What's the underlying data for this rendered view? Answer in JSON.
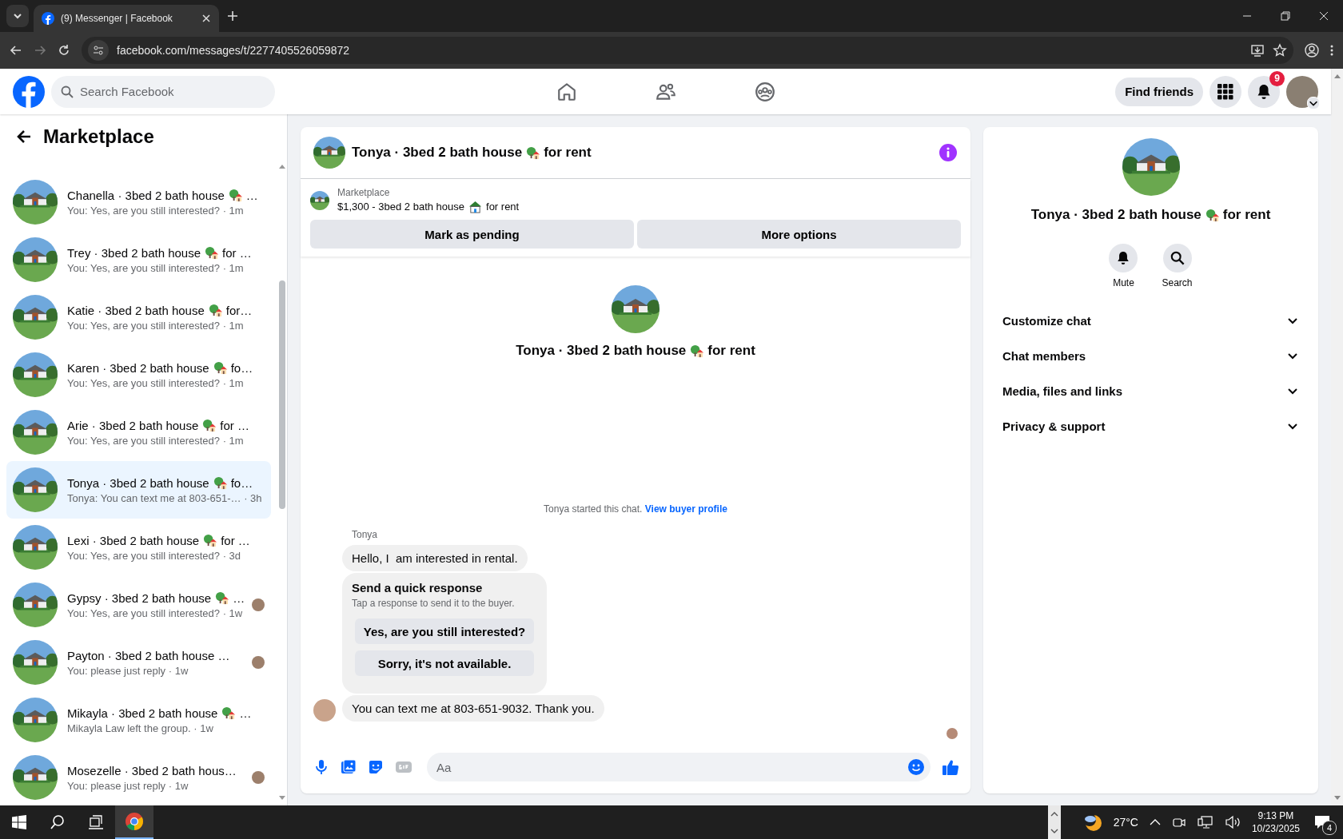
{
  "browser": {
    "tab_title": "(9) Messenger | Facebook",
    "url": "facebook.com/messages/t/2277405526059872"
  },
  "facebook_nav": {
    "search": {
      "placeholder": "Search Facebook"
    },
    "find_friends": "Find friends",
    "notification_count": "9"
  },
  "sidebar": {
    "title": "Marketplace",
    "conversations": [
      {
        "name": "Chanella · 3bed 2 bath house",
        "emoji": true,
        "name_end": "…",
        "preview": "You: Yes, are you still interested? · 1m",
        "selected": false,
        "seen_avatar": false
      },
      {
        "name": "Trey · 3bed 2 bath house",
        "emoji": true,
        "name_end": "for …",
        "preview": "You: Yes, are you still interested? · 1m",
        "selected": false,
        "seen_avatar": false
      },
      {
        "name": "Katie · 3bed 2 bath house",
        "emoji": true,
        "name_end": "for…",
        "preview": "You: Yes, are you still interested? · 1m",
        "selected": false,
        "seen_avatar": false
      },
      {
        "name": "Karen · 3bed 2 bath house",
        "emoji": true,
        "name_end": "fo…",
        "preview": "You: Yes, are you still interested? · 1m",
        "selected": false,
        "seen_avatar": false
      },
      {
        "name": "Arie · 3bed 2 bath house",
        "emoji": true,
        "name_end": "for …",
        "preview": "You: Yes, are you still interested? · 1m",
        "selected": false,
        "seen_avatar": false
      },
      {
        "name": "Tonya · 3bed 2 bath house",
        "emoji": true,
        "name_end": "fo…",
        "preview": "Tonya: You can text me at 803-651-… · 3h",
        "selected": true,
        "seen_avatar": false
      },
      {
        "name": "Lexi · 3bed 2 bath house",
        "emoji": true,
        "name_end": "for …",
        "preview": "You: Yes, are you still interested? · 3d",
        "selected": false,
        "seen_avatar": false
      },
      {
        "name": "Gypsy · 3bed 2 bath house",
        "emoji": true,
        "name_end": "…",
        "preview": "You: Yes, are you still interested? · 1w",
        "selected": false,
        "seen_avatar": true
      },
      {
        "name": "Payton · 3bed 2 bath house …",
        "emoji": false,
        "preview": "You: please just reply · 1w",
        "selected": false,
        "seen_avatar": true
      },
      {
        "name": "Mikayla · 3bed 2 bath house",
        "emoji": true,
        "name_end": "…",
        "preview": "Mikayla Law left the group. · 1w",
        "selected": false,
        "seen_avatar": false
      },
      {
        "name": "Mosezelle · 3bed 2 bath hous…",
        "emoji": false,
        "preview": "You: please just reply · 1w",
        "selected": false,
        "seen_avatar": true
      }
    ]
  },
  "chat": {
    "title": {
      "before": "Tonya · 3bed 2 bath house",
      "after": "for rent"
    },
    "listing": {
      "label": "Marketplace",
      "before": "$1,300 - 3bed 2 bath house",
      "after": "for rent"
    },
    "actions": [
      "Mark as pending",
      "More options"
    ],
    "intro_title": {
      "before": "Tonya · 3bed 2 bath house",
      "after": "for rent"
    },
    "started_text": "Tonya started this chat.",
    "started_link": "View buyer profile",
    "sender": "Tonya",
    "messages": [
      {
        "kind": "text",
        "text": "Hello, I  am interested in rental.",
        "avatar": false
      },
      {
        "kind": "quick_response",
        "title": "Send a quick response",
        "subtitle": "Tap a response to send it to the buyer.",
        "options": [
          "Yes, are you still interested?",
          "Sorry, it's not available."
        ]
      },
      {
        "kind": "text",
        "text": "You can text me at 803-651-9032. Thank you.",
        "avatar": true
      }
    ],
    "composer": {
      "placeholder": "Aa"
    }
  },
  "details": {
    "title": {
      "before": "Tonya · 3bed 2 bath house",
      "after": "for rent"
    },
    "actions": [
      {
        "kind": "mute",
        "label": "Mute"
      },
      {
        "kind": "search",
        "label": "Search"
      }
    ],
    "sections": [
      {
        "label": "Customize chat",
        "expanded": false
      },
      {
        "label": "Chat members",
        "expanded": false
      },
      {
        "label": "Media, files and links",
        "expanded": false
      },
      {
        "label": "Privacy & support",
        "expanded": false
      }
    ]
  },
  "taskbar": {
    "temperature": "27°C",
    "time": "9:13 PM",
    "date": "10/23/2025",
    "notification_count": "4"
  }
}
